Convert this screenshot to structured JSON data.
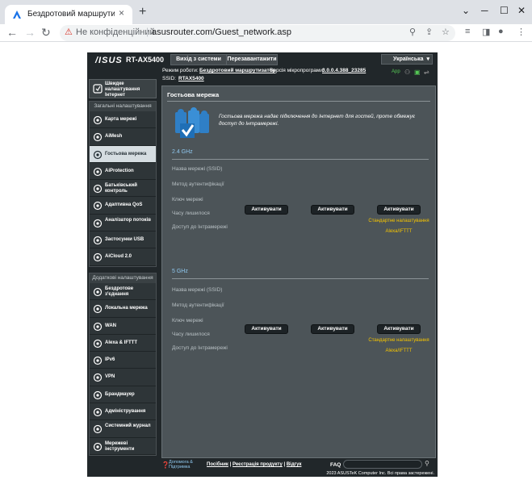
{
  "browser": {
    "tab_title": "Бездротовий маршрутизатор AS",
    "new_tab": "+",
    "tab_close": "×",
    "security": "Не конфіденційний",
    "url": "asusrouter.com/Guest_network.asp",
    "win_minimize": "─",
    "win_maximize": "☐",
    "win_close": "✕"
  },
  "router": {
    "logo": "/ISUS",
    "model": "RT-AX5400",
    "logout_label": "Вихід з системи",
    "reboot_label": "Перезавантажити",
    "language": "Українська",
    "status": {
      "mode_label": "Режим роботи:",
      "mode_value": "Бездротовий маршрутизатор",
      "firmware_label": "Версія мікропрограми:",
      "firmware_value": "3.0.0.4.388_23285",
      "ssid_label": "SSID:",
      "ssid_value": "RTAX5400",
      "app_label": "App"
    },
    "sidebar": {
      "qis_label": "Швидке налаштування Інтернет",
      "general_title": "Загальні налаштування",
      "general_items": [
        {
          "label": "Карта мережі",
          "icon": "network-map-icon"
        },
        {
          "label": "AiMesh",
          "icon": "aimesh-icon"
        },
        {
          "label": "Гостьова мережа",
          "icon": "guest-network-icon"
        },
        {
          "label": "AiProtection",
          "icon": "aiprotection-icon"
        },
        {
          "label": "Батьківський контроль",
          "icon": "parental-control-icon"
        },
        {
          "label": "Адаптивна QoS",
          "icon": "qos-icon"
        },
        {
          "label": "Аналізатор потоків",
          "icon": "traffic-analyzer-icon"
        },
        {
          "label": "Застосунки USB",
          "icon": "usb-icon"
        },
        {
          "label": "AiCloud 2.0",
          "icon": "aicloud-icon"
        }
      ],
      "advanced_title": "Додаткові налаштування",
      "advanced_items": [
        {
          "label": "Бездротове з'єднання",
          "icon": "wireless-icon"
        },
        {
          "label": "Локальна мережа",
          "icon": "lan-icon"
        },
        {
          "label": "WAN",
          "icon": "wan-icon"
        },
        {
          "label": "Alexa & IFTTT",
          "icon": "alexa-icon"
        },
        {
          "label": "IPv6",
          "icon": "ipv6-icon"
        },
        {
          "label": "VPN",
          "icon": "vpn-icon"
        },
        {
          "label": "Брандмауер",
          "icon": "firewall-icon"
        },
        {
          "label": "Адміністрування",
          "icon": "administration-icon"
        },
        {
          "label": "Системний журнал",
          "icon": "system-log-icon"
        },
        {
          "label": "Мережеві інструменти",
          "icon": "network-tools-icon"
        }
      ]
    },
    "content": {
      "title": "Гостьова мережа",
      "description": "Гостьова мережа надає підключення до Інтернет для гостей, проте обмежує доступ до Інтрамережі.",
      "rows": [
        "Назва мережі (SSID)",
        "Метод аутентифікації",
        "Ключ мережі",
        "Часу лишилося",
        "Доступ до Інтрамережі"
      ],
      "band_24": "2.4 GHz",
      "band_5": "5 GHz",
      "activate": "Активувати",
      "default_settings": "Стандартне налаштування",
      "alexa_ifttt": "Alexa/IFTTT"
    },
    "footer": {
      "help": "Допомога & Підтримка",
      "manual": "Посібник",
      "registration": "Реєстрація продукту",
      "feedback": "Відгук",
      "separator": "|",
      "faq": "FAQ",
      "copyright": "2023 ASUSTeK Computer Inc. Всі права застережені."
    }
  },
  "colors": {
    "accent_blue": "#1a73e8",
    "router_bg": "#21272a",
    "link_yellow": "#f5c400",
    "band_blue": "#8fc8ef"
  }
}
